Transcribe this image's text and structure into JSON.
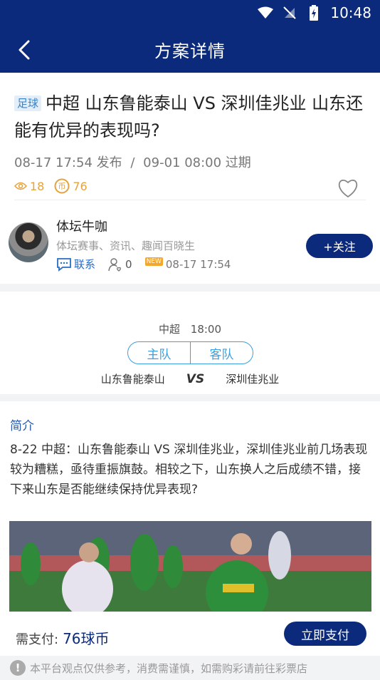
{
  "status_bar": {
    "time": "10:48"
  },
  "header": {
    "title": "方案详情"
  },
  "article": {
    "tag": "足球",
    "title": "中超 山东鲁能泰山 VS 深圳佳兆业 山东还能有优异的表现吗?",
    "publish_time": "08-17 17:54 发布",
    "separator": "/",
    "expire_time": "09-01 08:00 过期",
    "views": "18",
    "coins": "76"
  },
  "author": {
    "name": "体坛牛咖",
    "desc": "体坛赛事、资讯、趣闻百晓生",
    "contact_label": "联系",
    "fans_count": "0",
    "new_badge": "NEW",
    "time": "08-17 17:54",
    "follow_label": "+关注"
  },
  "match": {
    "league": "中超",
    "time": "18:00",
    "home_tab": "主队",
    "away_tab": "客队",
    "home_team": "山东鲁能泰山",
    "vs": "VS",
    "away_team": "深圳佳兆业"
  },
  "intro": {
    "title": "简介",
    "text": "8-22 中超：山东鲁能泰山 VS 深圳佳兆业，深圳佳兆业前几场表现较为糟糕，亟待重振旗鼓。相较之下，山东换人之后成绩不错，接下来山东是否能继续保持优异表现?"
  },
  "payment": {
    "label": "需支付:",
    "amount": "76球币",
    "button": "立即支付"
  },
  "notice": {
    "text": "本平台观点仅供参考，消费需谨慎，如需购彩请前往彩票店"
  },
  "colors": {
    "brand": "#0b2a7c",
    "accent_blue": "#3b9fe0",
    "coin": "#e6a23c"
  }
}
